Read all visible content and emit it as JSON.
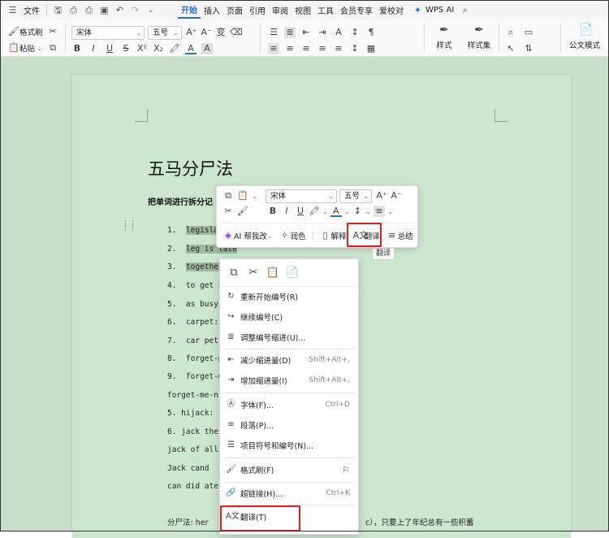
{
  "menubar": {
    "file": "文件",
    "tabs": [
      "开始",
      "插入",
      "页面",
      "引用",
      "审阅",
      "视图",
      "工具",
      "会员专享",
      "爱校对"
    ],
    "wps_ai": "WPS AI"
  },
  "ribbon": {
    "format_painter": "格式刷",
    "paste": "粘贴",
    "font_name": "宋体",
    "font_size": "五号",
    "styles": "样式",
    "style_set": "样式集",
    "official_mode": "公文模式"
  },
  "document": {
    "title": "五马分尸法",
    "subtitle": "把单词进行拆分记",
    "lines": [
      {
        "n": "1.",
        "t": "legislat"
      },
      {
        "n": "2.",
        "t": "leg is late"
      },
      {
        "n": "3.",
        "t": "together"
      },
      {
        "n": "4.",
        "t": "to get h"
      },
      {
        "n": "5.",
        "t": "as busy"
      },
      {
        "n": "6.",
        "t": "carpet:r"
      },
      {
        "n": "7.",
        "t": "car pet"
      },
      {
        "n": "8.",
        "t": "forget-m"
      },
      {
        "n": "9.",
        "t": "forget-m"
      }
    ],
    "plain_lines": [
      "forget-me-n",
      "5. hijack:",
      "6. jack the",
      "jack of all",
      "Jack   cand",
      "can did ate"
    ],
    "bottom_left": "分尸法: her",
    "bottom_right": "c），只要上了年纪总有一些积蓄"
  },
  "mini_toolbar": {
    "font_name": "宋体",
    "font_size": "五号",
    "ai_help": "AI 帮我改",
    "polish": "润色",
    "explain": "解释",
    "translate": "翻译",
    "summary": "总结",
    "tooltip": "翻译"
  },
  "context_menu": {
    "items": [
      {
        "label": "重新开始编号(R)",
        "shortcut": ""
      },
      {
        "label": "继续编号(C)",
        "shortcut": ""
      },
      {
        "label": "调整编号缩进(U)...",
        "shortcut": ""
      },
      {
        "label": "减少缩进量(D)",
        "shortcut": "Shift+Alt+,"
      },
      {
        "label": "增加缩进量(I)",
        "shortcut": "Shift+Alt+."
      },
      {
        "label": "字体(F)...",
        "shortcut": "Ctrl+D"
      },
      {
        "label": "段落(P)...",
        "shortcut": ""
      },
      {
        "label": "项目符号和编号(N)...",
        "shortcut": ""
      },
      {
        "label": "格式刷(F)",
        "shortcut": ""
      },
      {
        "label": "超链接(H)...",
        "shortcut": "Ctrl+K"
      },
      {
        "label": "翻译(T)",
        "shortcut": ""
      }
    ]
  },
  "colors": {
    "accent": "#2f6ae6",
    "highlight_box": "#e02020",
    "doc_bg": "#c9dfca",
    "page_bg": "#cde7cf"
  }
}
